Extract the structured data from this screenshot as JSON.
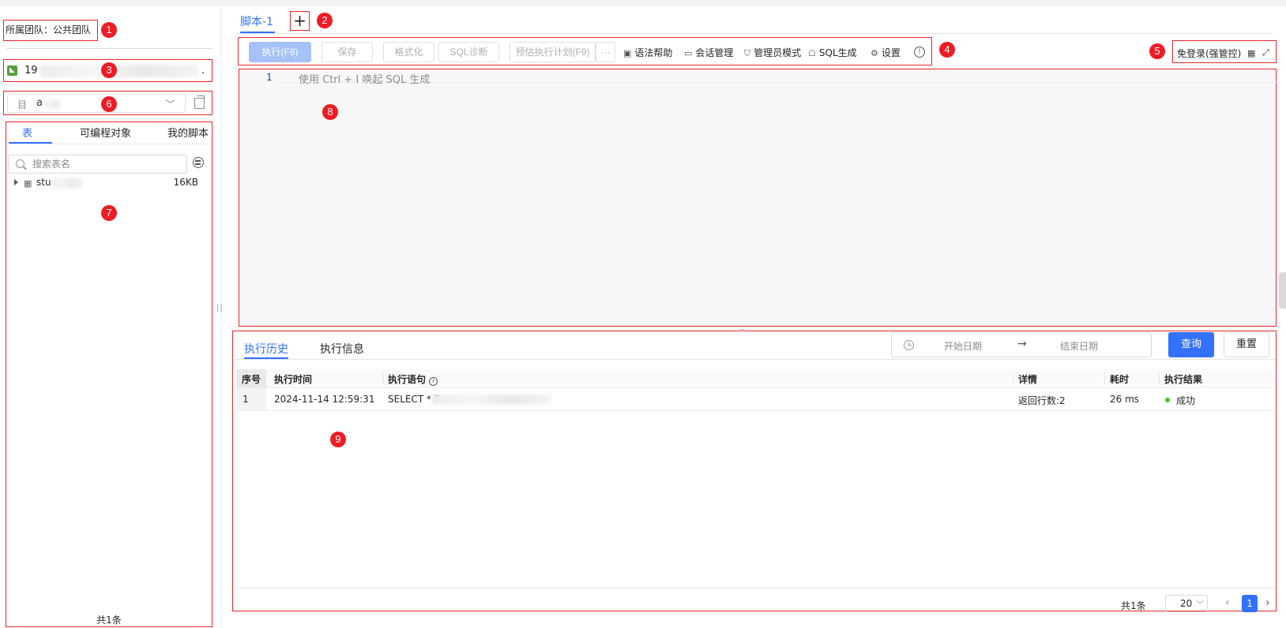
{
  "team": {
    "label": "所属团队：公共团队"
  },
  "connection": {
    "prefix": "19",
    "suffix": "."
  },
  "schema": {
    "value": "a"
  },
  "left_tabs": [
    {
      "label": "表"
    },
    {
      "label": "可编程对象"
    },
    {
      "label": "我的脚本"
    }
  ],
  "table_search": {
    "placeholder": "搜索表名"
  },
  "tables": [
    {
      "name": "stu",
      "size": "16KB"
    }
  ],
  "left_footer": {
    "total": "共1条"
  },
  "script_tabs": [
    {
      "label": "脚本-1"
    }
  ],
  "add_tab": {
    "label": "+"
  },
  "toolbar": {
    "execute": "执行(F8)",
    "save": "保存",
    "format": "格式化",
    "sql_diagnose": "SQL诊断",
    "explain": "预估执行计划(F9)",
    "more": "···",
    "syntax_help": "语法帮助",
    "session_manage": "会话管理",
    "admin_mode": "管理员模式",
    "sql_generate": "SQL生成",
    "settings": "设置",
    "info": "!"
  },
  "login_mode": {
    "label": "免登录(强管控)"
  },
  "editor": {
    "line_number": "1",
    "hint": "使用 Ctrl + I 唤起 SQL 生成"
  },
  "bottom_tabs": [
    {
      "label": "执行历史"
    },
    {
      "label": "执行信息"
    }
  ],
  "date_range": {
    "start_placeholder": "开始日期",
    "arrow": "→",
    "end_placeholder": "结束日期"
  },
  "query_button": {
    "label": "查询"
  },
  "reset_button": {
    "label": "重置"
  },
  "history_table": {
    "columns": [
      "序号",
      "执行时间",
      "执行语句",
      "详情",
      "耗时",
      "执行结果"
    ],
    "rows": [
      {
        "seq": "1",
        "time": "2024-11-14 12:59:31",
        "statement": "SELECT * F",
        "detail": "返回行数:2",
        "duration": "26 ms",
        "result": "成功"
      }
    ]
  },
  "pagination": {
    "total": "共1条",
    "page_size": "20",
    "current_page": "1"
  },
  "markers": [
    "1",
    "2",
    "3",
    "4",
    "5",
    "6",
    "7",
    "8",
    "9"
  ],
  "colors": {
    "accent": "#3371ff",
    "annotation_red": "#e8262b",
    "success": "#52c41a"
  }
}
